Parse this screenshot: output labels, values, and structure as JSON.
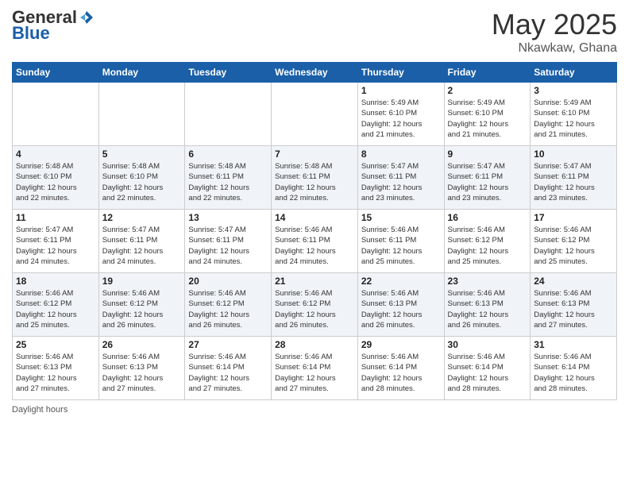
{
  "header": {
    "logo_general": "General",
    "logo_blue": "Blue",
    "month_title": "May 2025",
    "location": "Nkawkaw, Ghana"
  },
  "days_of_week": [
    "Sunday",
    "Monday",
    "Tuesday",
    "Wednesday",
    "Thursday",
    "Friday",
    "Saturday"
  ],
  "weeks": [
    [
      {
        "day": "",
        "info": ""
      },
      {
        "day": "",
        "info": ""
      },
      {
        "day": "",
        "info": ""
      },
      {
        "day": "",
        "info": ""
      },
      {
        "day": "1",
        "info": "Sunrise: 5:49 AM\nSunset: 6:10 PM\nDaylight: 12 hours\nand 21 minutes."
      },
      {
        "day": "2",
        "info": "Sunrise: 5:49 AM\nSunset: 6:10 PM\nDaylight: 12 hours\nand 21 minutes."
      },
      {
        "day": "3",
        "info": "Sunrise: 5:49 AM\nSunset: 6:10 PM\nDaylight: 12 hours\nand 21 minutes."
      }
    ],
    [
      {
        "day": "4",
        "info": "Sunrise: 5:48 AM\nSunset: 6:10 PM\nDaylight: 12 hours\nand 22 minutes."
      },
      {
        "day": "5",
        "info": "Sunrise: 5:48 AM\nSunset: 6:10 PM\nDaylight: 12 hours\nand 22 minutes."
      },
      {
        "day": "6",
        "info": "Sunrise: 5:48 AM\nSunset: 6:11 PM\nDaylight: 12 hours\nand 22 minutes."
      },
      {
        "day": "7",
        "info": "Sunrise: 5:48 AM\nSunset: 6:11 PM\nDaylight: 12 hours\nand 22 minutes."
      },
      {
        "day": "8",
        "info": "Sunrise: 5:47 AM\nSunset: 6:11 PM\nDaylight: 12 hours\nand 23 minutes."
      },
      {
        "day": "9",
        "info": "Sunrise: 5:47 AM\nSunset: 6:11 PM\nDaylight: 12 hours\nand 23 minutes."
      },
      {
        "day": "10",
        "info": "Sunrise: 5:47 AM\nSunset: 6:11 PM\nDaylight: 12 hours\nand 23 minutes."
      }
    ],
    [
      {
        "day": "11",
        "info": "Sunrise: 5:47 AM\nSunset: 6:11 PM\nDaylight: 12 hours\nand 24 minutes."
      },
      {
        "day": "12",
        "info": "Sunrise: 5:47 AM\nSunset: 6:11 PM\nDaylight: 12 hours\nand 24 minutes."
      },
      {
        "day": "13",
        "info": "Sunrise: 5:47 AM\nSunset: 6:11 PM\nDaylight: 12 hours\nand 24 minutes."
      },
      {
        "day": "14",
        "info": "Sunrise: 5:46 AM\nSunset: 6:11 PM\nDaylight: 12 hours\nand 24 minutes."
      },
      {
        "day": "15",
        "info": "Sunrise: 5:46 AM\nSunset: 6:11 PM\nDaylight: 12 hours\nand 25 minutes."
      },
      {
        "day": "16",
        "info": "Sunrise: 5:46 AM\nSunset: 6:12 PM\nDaylight: 12 hours\nand 25 minutes."
      },
      {
        "day": "17",
        "info": "Sunrise: 5:46 AM\nSunset: 6:12 PM\nDaylight: 12 hours\nand 25 minutes."
      }
    ],
    [
      {
        "day": "18",
        "info": "Sunrise: 5:46 AM\nSunset: 6:12 PM\nDaylight: 12 hours\nand 25 minutes."
      },
      {
        "day": "19",
        "info": "Sunrise: 5:46 AM\nSunset: 6:12 PM\nDaylight: 12 hours\nand 26 minutes."
      },
      {
        "day": "20",
        "info": "Sunrise: 5:46 AM\nSunset: 6:12 PM\nDaylight: 12 hours\nand 26 minutes."
      },
      {
        "day": "21",
        "info": "Sunrise: 5:46 AM\nSunset: 6:12 PM\nDaylight: 12 hours\nand 26 minutes."
      },
      {
        "day": "22",
        "info": "Sunrise: 5:46 AM\nSunset: 6:13 PM\nDaylight: 12 hours\nand 26 minutes."
      },
      {
        "day": "23",
        "info": "Sunrise: 5:46 AM\nSunset: 6:13 PM\nDaylight: 12 hours\nand 26 minutes."
      },
      {
        "day": "24",
        "info": "Sunrise: 5:46 AM\nSunset: 6:13 PM\nDaylight: 12 hours\nand 27 minutes."
      }
    ],
    [
      {
        "day": "25",
        "info": "Sunrise: 5:46 AM\nSunset: 6:13 PM\nDaylight: 12 hours\nand 27 minutes."
      },
      {
        "day": "26",
        "info": "Sunrise: 5:46 AM\nSunset: 6:13 PM\nDaylight: 12 hours\nand 27 minutes."
      },
      {
        "day": "27",
        "info": "Sunrise: 5:46 AM\nSunset: 6:14 PM\nDaylight: 12 hours\nand 27 minutes."
      },
      {
        "day": "28",
        "info": "Sunrise: 5:46 AM\nSunset: 6:14 PM\nDaylight: 12 hours\nand 27 minutes."
      },
      {
        "day": "29",
        "info": "Sunrise: 5:46 AM\nSunset: 6:14 PM\nDaylight: 12 hours\nand 28 minutes."
      },
      {
        "day": "30",
        "info": "Sunrise: 5:46 AM\nSunset: 6:14 PM\nDaylight: 12 hours\nand 28 minutes."
      },
      {
        "day": "31",
        "info": "Sunrise: 5:46 AM\nSunset: 6:14 PM\nDaylight: 12 hours\nand 28 minutes."
      }
    ]
  ],
  "footer": {
    "daylight_label": "Daylight hours"
  }
}
